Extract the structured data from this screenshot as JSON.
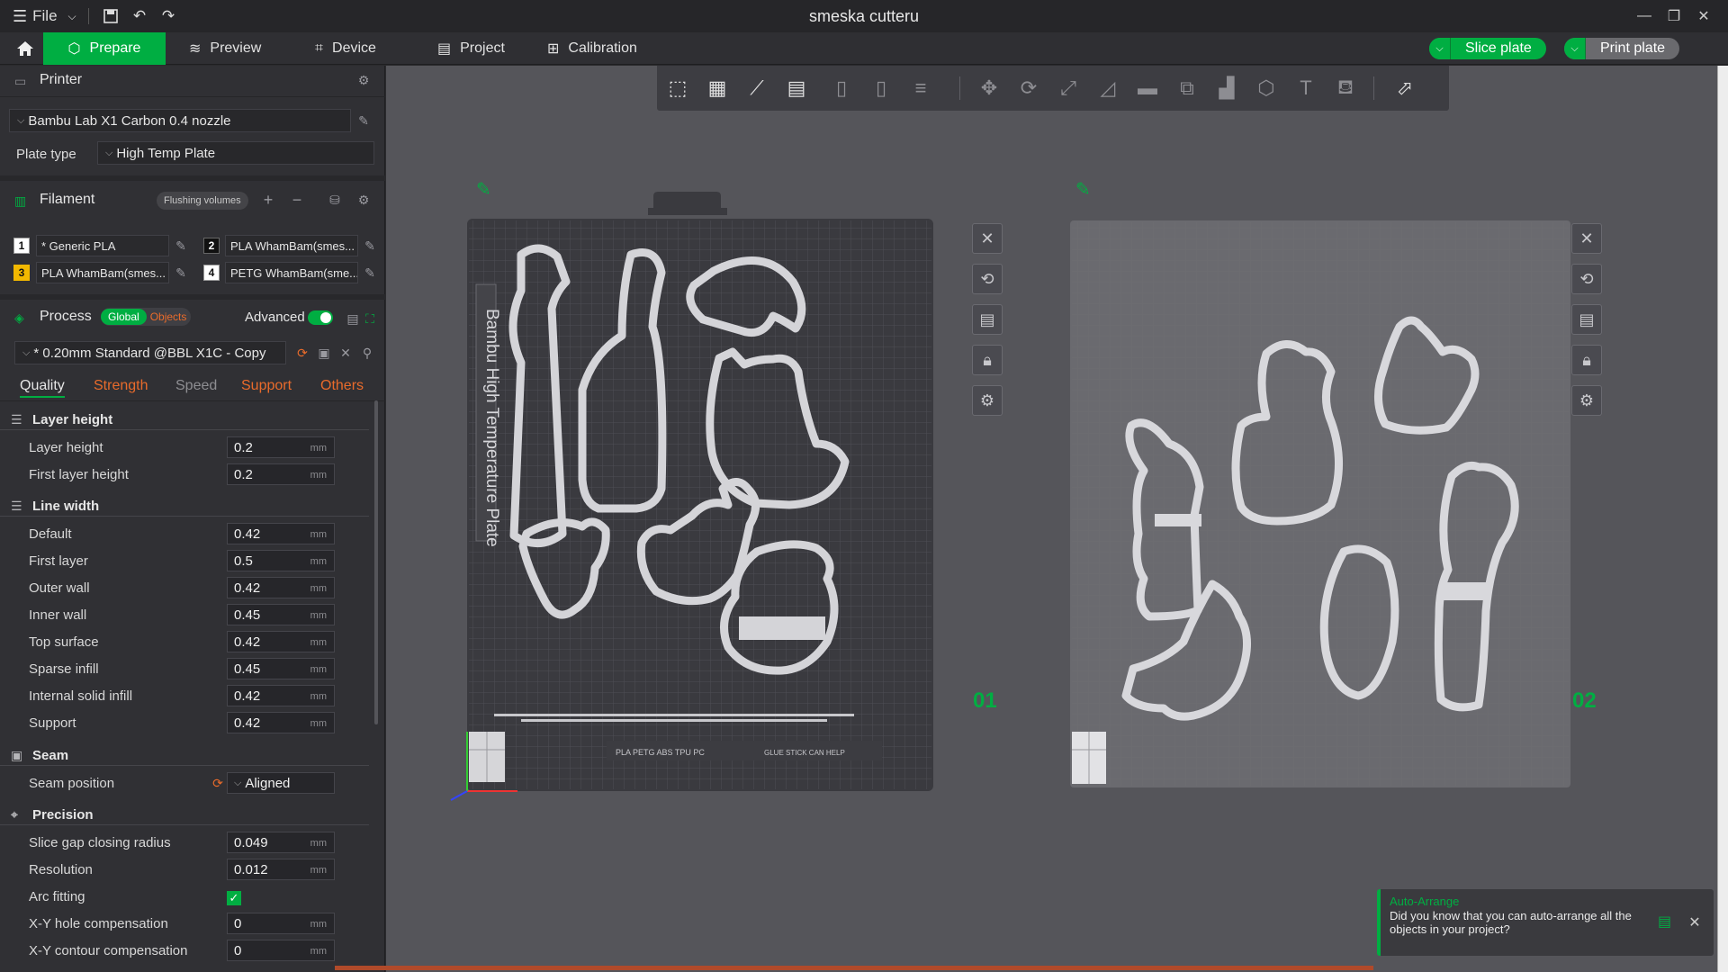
{
  "window": {
    "title": "smeska cutteru",
    "menu_label": "File"
  },
  "nav": {
    "tabs": [
      {
        "label": "Prepare",
        "icon": "cube-icon"
      },
      {
        "label": "Preview",
        "icon": "layers-icon"
      },
      {
        "label": "Device",
        "icon": "device-icon"
      },
      {
        "label": "Project",
        "icon": "project-icon"
      },
      {
        "label": "Calibration",
        "icon": "calibration-icon"
      }
    ],
    "active_tab": "Prepare",
    "slice_label": "Slice plate",
    "print_label": "Print plate",
    "accent_color": "#00ae42"
  },
  "printer": {
    "section_label": "Printer",
    "printer_name": "Bambu Lab X1 Carbon 0.4 nozzle",
    "plate_type_label": "Plate type",
    "plate_type_value": "High Temp Plate"
  },
  "filament": {
    "section_label": "Filament",
    "flushing_label": "Flushing volumes",
    "items": [
      {
        "num": "1",
        "name": "* Generic PLA",
        "color": "#ffffff"
      },
      {
        "num": "2",
        "name": "PLA  WhamBam(smes...",
        "color": "#111111"
      },
      {
        "num": "3",
        "name": "PLA  WhamBam(smes...",
        "color": "#f2b800"
      },
      {
        "num": "4",
        "name": "PETG WhamBam(sme...",
        "color": "#ffffff"
      }
    ]
  },
  "process": {
    "section_label": "Process",
    "global_label": "Global",
    "objects_label": "Objects",
    "advanced_label": "Advanced",
    "preset": "* 0.20mm Standard @BBL X1C - Copy",
    "tabs": [
      "Quality",
      "Strength",
      "Speed",
      "Support",
      "Others"
    ],
    "active_tab": "Quality"
  },
  "groups": {
    "layer_height": {
      "title": "Layer height",
      "rows": [
        {
          "label": "Layer height",
          "value": "0.2",
          "unit": "mm"
        },
        {
          "label": "First layer height",
          "value": "0.2",
          "unit": "mm"
        }
      ]
    },
    "line_width": {
      "title": "Line width",
      "rows": [
        {
          "label": "Default",
          "value": "0.42",
          "unit": "mm"
        },
        {
          "label": "First layer",
          "value": "0.5",
          "unit": "mm"
        },
        {
          "label": "Outer wall",
          "value": "0.42",
          "unit": "mm"
        },
        {
          "label": "Inner wall",
          "value": "0.45",
          "unit": "mm"
        },
        {
          "label": "Top surface",
          "value": "0.42",
          "unit": "mm"
        },
        {
          "label": "Sparse infill",
          "value": "0.45",
          "unit": "mm"
        },
        {
          "label": "Internal solid infill",
          "value": "0.42",
          "unit": "mm"
        },
        {
          "label": "Support",
          "value": "0.42",
          "unit": "mm"
        }
      ]
    },
    "seam": {
      "title": "Seam",
      "position_label": "Seam position",
      "position_value": "Aligned"
    },
    "precision": {
      "title": "Precision",
      "rows": [
        {
          "label": "Slice gap closing radius",
          "value": "0.049",
          "unit": "mm"
        },
        {
          "label": "Resolution",
          "value": "0.012",
          "unit": "mm"
        },
        {
          "label": "Arc fitting",
          "value": "",
          "unit": ""
        },
        {
          "label": "X-Y hole compensation",
          "value": "0",
          "unit": "mm"
        },
        {
          "label": "X-Y contour compensation",
          "value": "0",
          "unit": "mm"
        }
      ],
      "arc_fitting_checked": true
    }
  },
  "viewport": {
    "plate1_label": "01",
    "plate2_label": "02",
    "plate1_text": "Bambu High Temperature Plate",
    "plate1_footer": "PLA PETG ABS TPU PC",
    "plate1_footer2": "GLUE STICK CAN HELP"
  },
  "toast": {
    "title": "Auto-Arrange",
    "body": "Did you know that you can auto-arrange all the objects in your project?"
  }
}
